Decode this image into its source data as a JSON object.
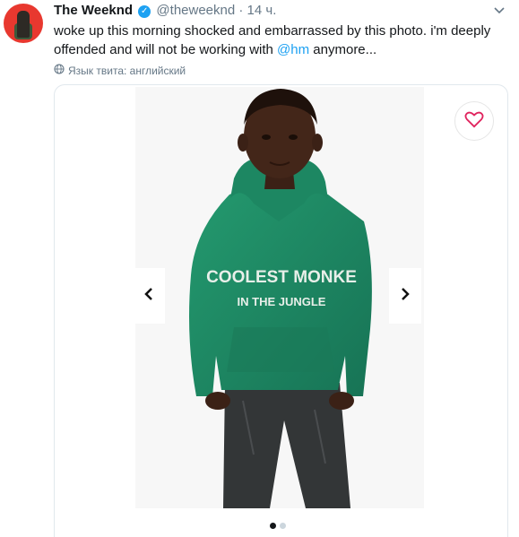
{
  "tweet": {
    "author_name": "The Weeknd",
    "handle": "@theweeknd",
    "separator": "·",
    "time": "14 ч.",
    "text_part1": "woke up this morning shocked and embarrassed by this photo. i'm deeply offended and will not be working with ",
    "mention": "@hm",
    "text_part2": " anymore...",
    "language_label": "Язык твита: английский"
  },
  "photo": {
    "hoodie_text_line1": "COOLEST MONKE",
    "hoodie_text_line2": "IN THE JUNGLE",
    "carousel_total": 2,
    "carousel_active_index": 0
  },
  "icons": {
    "verified": "verified-badge-icon",
    "caret": "chevron-down-icon",
    "globe": "globe-icon",
    "heart": "heart-icon",
    "prev": "chevron-left-icon",
    "next": "chevron-right-icon"
  },
  "colors": {
    "link": "#1da1f2",
    "muted": "#657786",
    "hoodie": "#1f8a63",
    "heart": "#e0245e"
  }
}
